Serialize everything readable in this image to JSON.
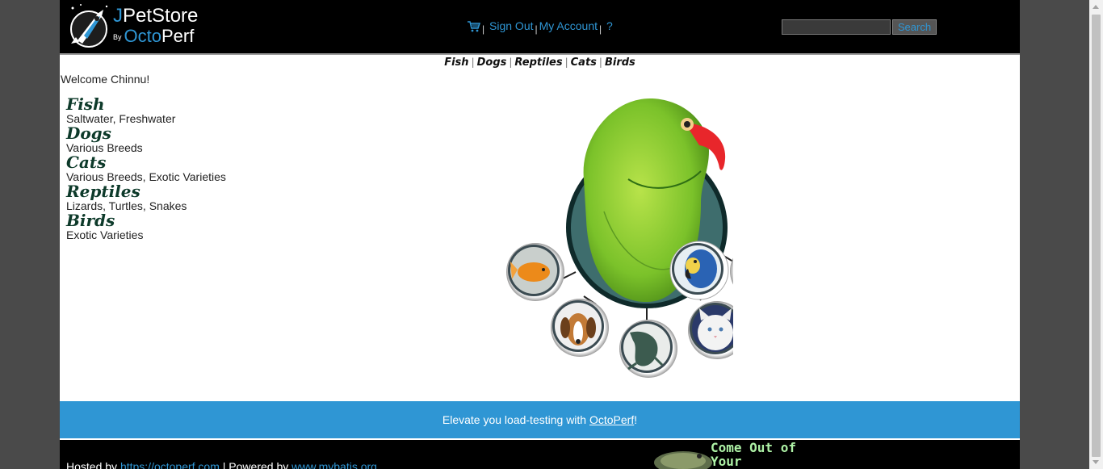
{
  "brand": {
    "name_j": "J",
    "name_rest": "PetStore",
    "by": "By",
    "octo": "Octo",
    "perf": "Perf"
  },
  "header_menu": {
    "sign_out": "Sign Out",
    "my_account": "My Account",
    "help": "?",
    "separator": "|"
  },
  "search": {
    "value": "",
    "button_label": "Search"
  },
  "quicklinks": [
    "Fish",
    "Dogs",
    "Reptiles",
    "Cats",
    "Birds"
  ],
  "welcome": "Welcome Chinnu!",
  "sidebar": [
    {
      "category": "Fish",
      "description": "Saltwater, Freshwater"
    },
    {
      "category": "Dogs",
      "description": "Various Breeds"
    },
    {
      "category": "Cats",
      "description": "Various Breeds, Exotic Varieties"
    },
    {
      "category": "Reptiles",
      "description": "Lizards, Turtles, Snakes"
    },
    {
      "category": "Birds",
      "description": "Exotic Varieties"
    }
  ],
  "banner": {
    "prefix": "Elevate you load-testing with ",
    "link": "OctoPerf",
    "suffix": "!"
  },
  "footer": {
    "hosted_prefix": "Hosted by ",
    "hosted_link": "https://octoperf.com",
    "powered_prefix": " | Powered by ",
    "powered_link": "www.mybatis.org",
    "promo_line1": "Come Out of",
    "promo_line2": "Your Shell..."
  },
  "colors": {
    "accent": "#2f96d4",
    "header_bg": "#000000",
    "category_text": "#0d3a2a"
  }
}
